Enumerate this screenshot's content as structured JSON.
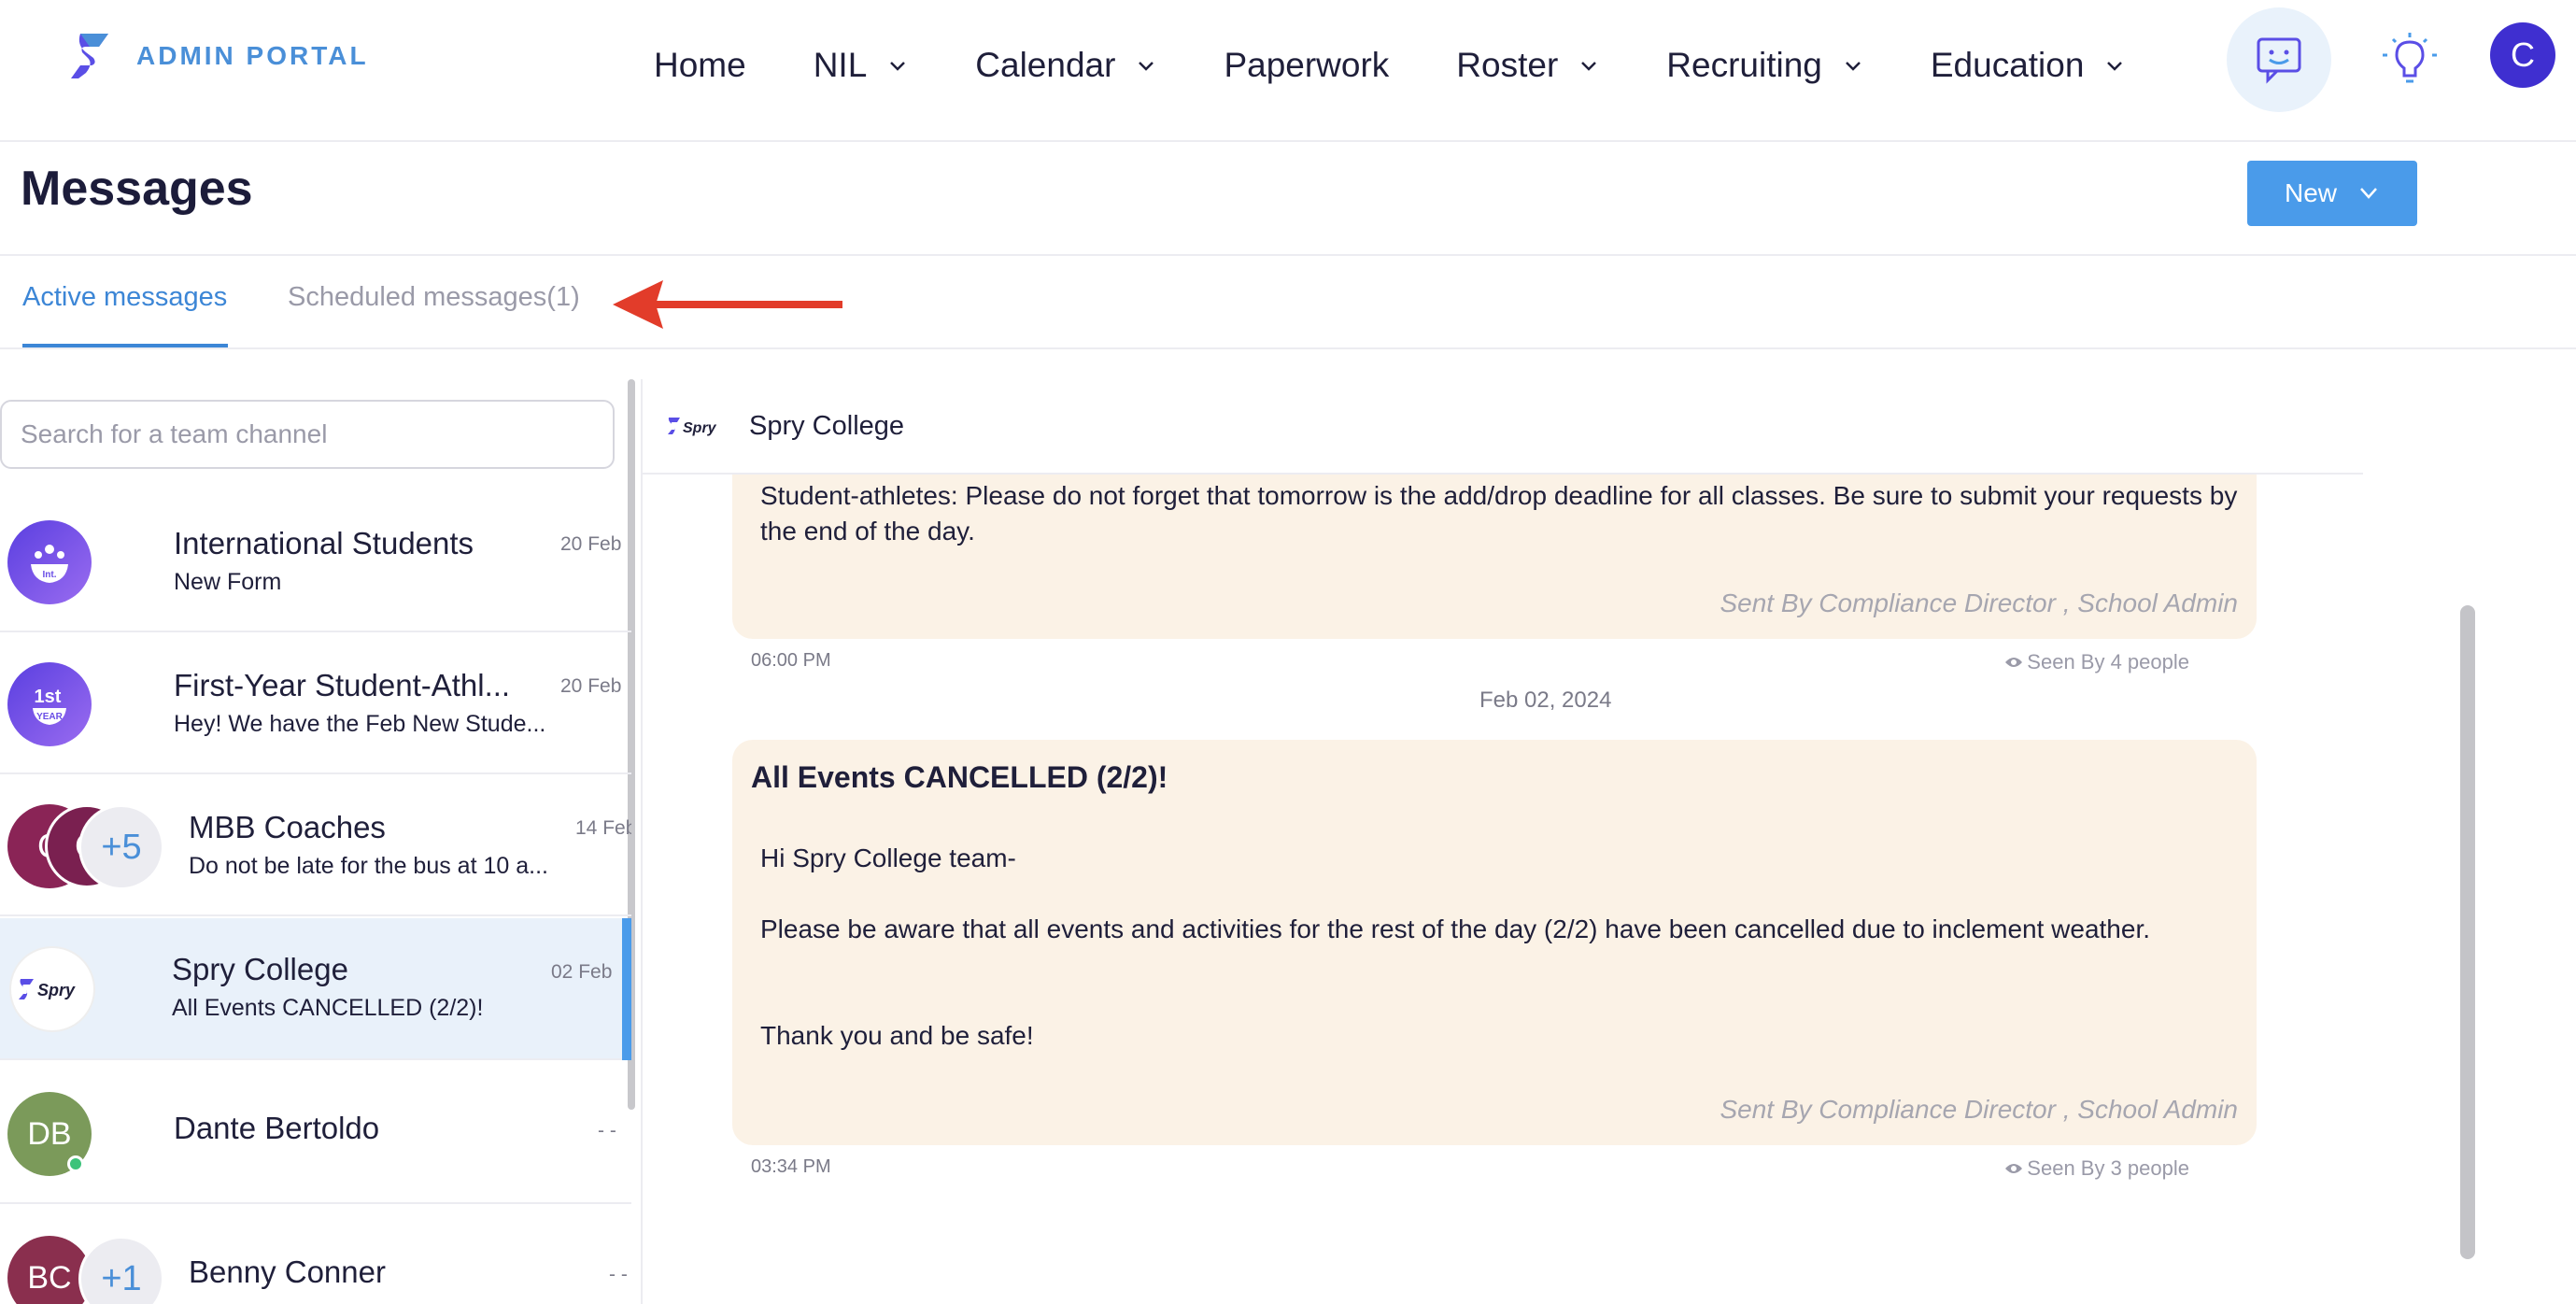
{
  "brand": {
    "name": "ADMIN PORTAL",
    "color": "#4a8fd8",
    "accent": "#4a9bea"
  },
  "nav": {
    "home": "Home",
    "nil": "NIL",
    "calendar": "Calendar",
    "paperwork": "Paperwork",
    "roster": "Roster",
    "recruiting": "Recruiting",
    "education": "Education",
    "user_initial": "C"
  },
  "page": {
    "title": "Messages",
    "new_label": "New"
  },
  "tabs": {
    "active": "Active messages",
    "scheduled": "Scheduled messages(1)"
  },
  "search": {
    "placeholder": "Search for a team channel"
  },
  "channels": [
    {
      "name": "International Students",
      "preview": "New Form",
      "date": "20 Feb",
      "icon": "globe-people-icon",
      "icon_text": "Int."
    },
    {
      "name": "First-Year Student-Athl...",
      "preview": "Hey! We have the Feb New Stude...",
      "date": "20 Feb",
      "icon_text_top": "1st",
      "icon_text_bottom": "YEAR"
    },
    {
      "name": "MBB Coaches",
      "preview": "Do not be late for the bus at 10 a...",
      "date": "14 Feb",
      "avatar_a": "C",
      "avatar_b": "C",
      "extra": "+5"
    },
    {
      "name": "Spry College",
      "preview": "All Events CANCELLED (2/2)!",
      "date": "02 Feb",
      "logo_text": "Spry"
    },
    {
      "name": "Dante Bertoldo",
      "preview": "",
      "date": "- -",
      "initials": "DB"
    },
    {
      "name": "Benny Conner",
      "preview": "",
      "date": "- -",
      "initials": "BC",
      "extra": "+1"
    }
  ],
  "conversation": {
    "name": "Spry College",
    "logo_text": "Spry",
    "messages": [
      {
        "body": "Student-athletes: Please do not forget that tomorrow is the add/drop deadline for all classes. Be sure to submit your requests by the end of the day.",
        "sent_by": "Sent By Compliance Director , School Admin",
        "time": "06:00 PM",
        "seen": "Seen By 4 people"
      },
      {
        "title": "All Events CANCELLED (2/2)!",
        "greeting": "Hi Spry College team-",
        "body": "Please be aware that all events and activities for the rest of the day (2/2) have been cancelled due to inclement weather.",
        "closing": "Thank you and be safe!",
        "sent_by": "Sent By Compliance Director , School Admin",
        "time": "03:34 PM",
        "seen": "Seen By 3 people"
      }
    ],
    "date_separator": "Feb 02, 2024"
  }
}
